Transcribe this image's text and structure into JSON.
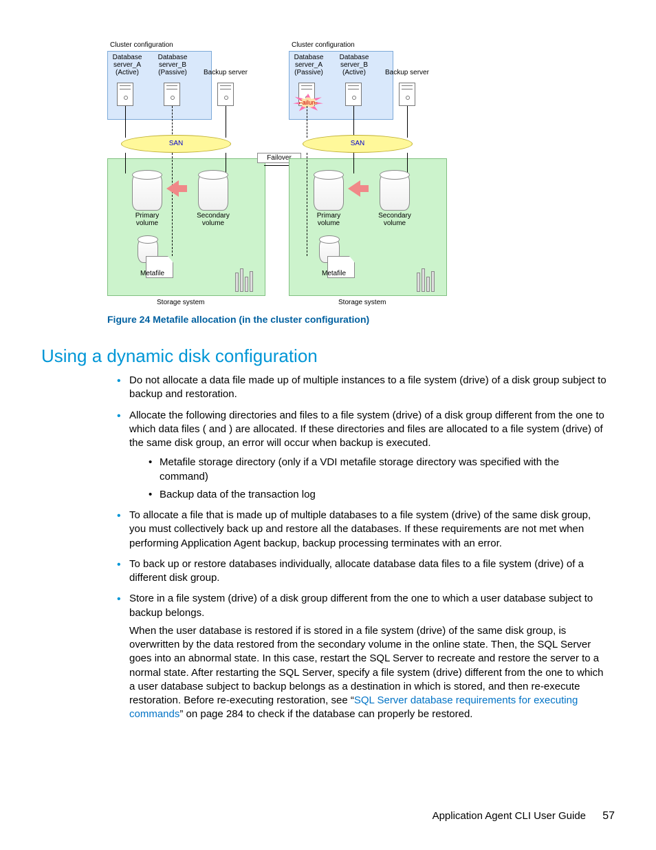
{
  "figure": {
    "caption": "Figure 24 Metafile allocation (in the cluster configuration)",
    "left": {
      "cluster_label": "Cluster configuration",
      "server_a": "Database\nserver_A\n(Active)",
      "server_b": "Database\nserver_B\n(Passive)",
      "backup_server": "Backup server",
      "san": "SAN",
      "primary_vol": "Primary\nvolume",
      "secondary_vol": "Secondary\nvolume",
      "metafile": "Metafile",
      "storage_system": "Storage system"
    },
    "failover_label": "Failover",
    "right": {
      "cluster_label": "Cluster configuration",
      "server_a": "Database\nserver_A\n(Passive)",
      "server_b": "Database\nserver_B\n(Active)",
      "backup_server": "Backup server",
      "failure": "Failure",
      "san": "SAN",
      "primary_vol": "Primary\nvolume",
      "secondary_vol": "Secondary\nvolume",
      "metafile": "Metafile",
      "storage_system": "Storage system"
    }
  },
  "heading": "Using a dynamic disk configuration",
  "bullets": {
    "b1": "Do not allocate a data file made up of multiple instances to a file system (drive) of a disk group subject to backup and restoration.",
    "b2": "Allocate the following directories and files to a file system (drive) of a disk group different from the one to which data files (           and          ) are allocated. If these directories and files are allocated to a file system (drive) of the same disk group, an error will occur when backup is executed.",
    "b2a": "Metafile storage directory (only if a VDI metafile storage directory was specified with the                      command)",
    "b2b": "Backup data of the transaction log",
    "b3": "To allocate a file that is made up of multiple databases to a file system (drive) of the same disk group, you must collectively back up and restore all the databases. If these requirements are not met when performing Application Agent backup, backup processing terminates with an error.",
    "b4": "To back up or restore databases individually, allocate database data files to a file system (drive) of a different disk group.",
    "b5": "Store              in a file system (drive) of a disk group different from the one to which a user database subject to backup belongs.",
    "b5p_a": "When the user database is restored if               is stored in a file system (drive) of the same disk group,              is overwritten by the data restored from the secondary volume in the online state. Then, the SQL Server goes into an abnormal state. In this case, restart the SQL Server to recreate              and restore the server to a normal state. After restarting the SQL Server, specify a file system (drive) different from the one to which a user database subject to backup belongs as a destination in which              is stored, and then re-execute restoration. Before re-executing restoration, see “",
    "b5p_link": "SQL Server database requirements for executing commands",
    "b5p_b": "” on page 284 to check if the database can properly be restored."
  },
  "footer": {
    "title": "Application Agent CLI User Guide",
    "page": "57"
  }
}
